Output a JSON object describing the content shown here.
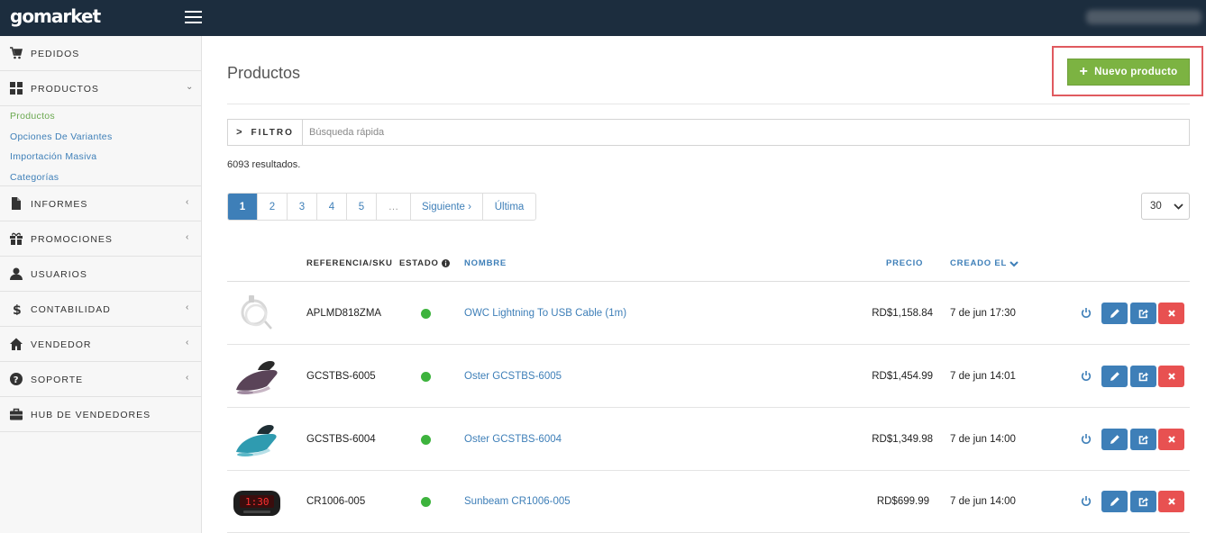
{
  "app": {
    "logo": "gomarket"
  },
  "sidebar": {
    "items": [
      {
        "label": "PEDIDOS"
      },
      {
        "label": "PRODUCTOS",
        "chevron": "⌄"
      },
      {
        "label": "INFORMES",
        "chevron": "‹"
      },
      {
        "label": "PROMOCIONES",
        "chevron": "‹"
      },
      {
        "label": "USUARIOS"
      },
      {
        "label": "CONTABILIDAD",
        "chevron": "‹"
      },
      {
        "label": "VENDEDOR",
        "chevron": "‹"
      },
      {
        "label": "SOPORTE",
        "chevron": "‹"
      },
      {
        "label": "HUB DE VENDEDORES"
      }
    ],
    "subitems": [
      {
        "label": "Productos"
      },
      {
        "label": "Opciones De Variantes"
      },
      {
        "label": "Importación Masiva"
      },
      {
        "label": "Categorías"
      }
    ]
  },
  "main": {
    "title": "Productos",
    "new_button": "Nuevo producto",
    "filter_label": "FILTRO",
    "search_placeholder": "Búsqueda rápida",
    "results": "6093 resultados.",
    "pagination": [
      "1",
      "2",
      "3",
      "4",
      "5",
      "…",
      "Siguiente ›",
      "Última"
    ],
    "per_page": "30"
  },
  "table": {
    "headers": {
      "sku": "REFERENCIA/SKU",
      "estado": "ESTADO",
      "nombre": "NOMBRE",
      "precio": "PRECIO",
      "creado": "CREADO EL"
    },
    "rows": [
      {
        "sku": "APLMD818ZMA",
        "name": "OWC Lightning To USB Cable (1m)",
        "price": "RD$1,158.84",
        "created": "7 de jun 17:30"
      },
      {
        "sku": "GCSTBS-6005",
        "name": "Oster GCSTBS-6005",
        "price": "RD$1,454.99",
        "created": "7 de jun 14:01"
      },
      {
        "sku": "GCSTBS-6004",
        "name": "Oster GCSTBS-6004",
        "price": "RD$1,349.98",
        "created": "7 de jun 14:00"
      },
      {
        "sku": "CR1006-005",
        "name": "Sunbeam CR1006-005",
        "price": "RD$699.99",
        "created": "7 de jun 14:00"
      }
    ]
  },
  "colors": {
    "accent": "#3e7fb8",
    "success": "#7cb342",
    "danger": "#e85151",
    "topbar": "#1c2d3e",
    "highlight": "#e05a5f"
  },
  "clock_display": "1:30"
}
